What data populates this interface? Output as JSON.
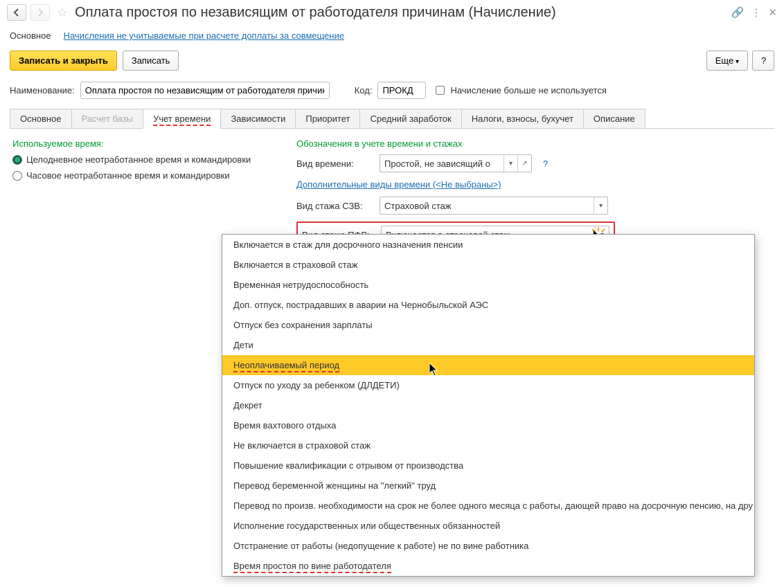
{
  "title": "Оплата простоя по независящим от работодателя причинам (Начисление)",
  "subnav": {
    "main": "Основное",
    "link": "Начисления не учитываемые при расчете доплаты за совмещение"
  },
  "toolbar": {
    "save_close": "Записать и закрыть",
    "save": "Записать",
    "more": "Еще",
    "help": "?"
  },
  "form": {
    "name_label": "Наименование:",
    "name_value": "Оплата простоя по независящим от работодателя причинам",
    "code_label": "Код:",
    "code_value": "ПРОКД",
    "not_used_label": "Начисление больше не используется"
  },
  "tabs": [
    {
      "label": "Основное"
    },
    {
      "label": "Расчет базы",
      "disabled": true
    },
    {
      "label": "Учет времени",
      "active": true
    },
    {
      "label": "Зависимости"
    },
    {
      "label": "Приоритет"
    },
    {
      "label": "Средний заработок"
    },
    {
      "label": "Налоги, взносы, бухучет"
    },
    {
      "label": "Описание"
    }
  ],
  "time_tab": {
    "used_time_title": "Используемое время:",
    "radio1": "Целодневное неотработанное время и командировки",
    "radio2": "Часовое неотработанное время и командировки",
    "designations_title": "Обозначения в учете времени и стажах",
    "time_type_label": "Вид времени:",
    "time_type_value": "Простой, не зависящий о",
    "additional_link": "Дополнительные виды времени (<Не выбраны>)",
    "szv_label": "Вид стажа СЗВ:",
    "szv_value": "Страховой стаж",
    "pfr_label": "Вид стажа ПФР:",
    "pfr_value": "Включается в страховой стаж"
  },
  "dropdown_items": [
    {
      "text": "Включается в стаж для досрочного назначения пенсии"
    },
    {
      "text": "Включается в страховой стаж"
    },
    {
      "text": "Временная нетрудоспособность"
    },
    {
      "text": "Доп. отпуск, пострадавших в аварии на Чернобыльской АЭС"
    },
    {
      "text": "Отпуск без сохранения зарплаты"
    },
    {
      "text": "Дети"
    },
    {
      "text": "Неоплачиваемый период",
      "highlighted": true,
      "underline": true
    },
    {
      "text": "Отпуск по уходу за ребенком (ДЛДЕТИ)"
    },
    {
      "text": "Декрет"
    },
    {
      "text": "Время вахтового отдыха"
    },
    {
      "text": "Не включается в страховой стаж"
    },
    {
      "text": "Повышение квалификации с отрывом от производства"
    },
    {
      "text": "Перевод беременной женщины на \"легкий\" труд"
    },
    {
      "text": "Перевод по произв. необходимости на срок не более одного месяца с работы, дающей право на досрочную пенсию, на дру"
    },
    {
      "text": "Исполнение государственных или общественных обязанностей"
    },
    {
      "text": "Отстранение от работы (недопущение к работе) не по вине работника"
    },
    {
      "text": "Время простоя по вине работодателя",
      "underline": true
    }
  ]
}
